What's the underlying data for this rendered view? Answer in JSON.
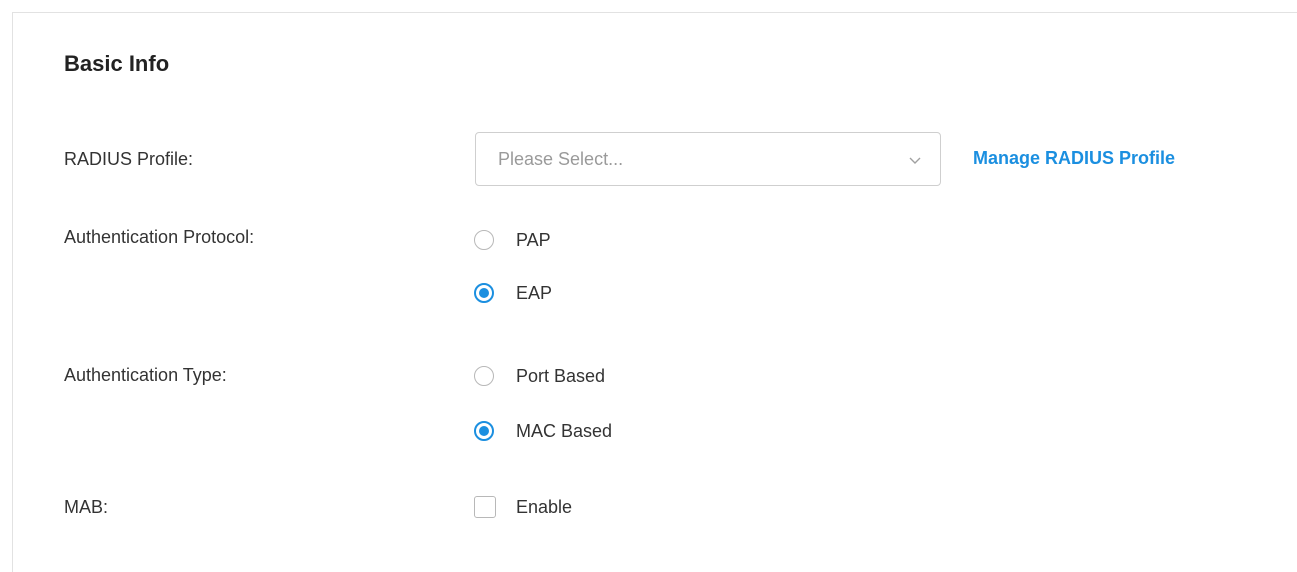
{
  "section": {
    "title": "Basic Info"
  },
  "radius_profile": {
    "label": "RADIUS Profile:",
    "placeholder": "Please Select...",
    "icon": "chevron-down-icon",
    "manage_link": "Manage RADIUS Profile"
  },
  "auth_protocol": {
    "label": "Authentication Protocol:",
    "options": [
      {
        "label": "PAP",
        "checked": false
      },
      {
        "label": "EAP",
        "checked": true
      }
    ]
  },
  "auth_type": {
    "label": "Authentication Type:",
    "options": [
      {
        "label": "Port Based",
        "checked": false
      },
      {
        "label": "MAC Based",
        "checked": true
      }
    ]
  },
  "mab": {
    "label": "MAB:",
    "checkbox_label": "Enable",
    "checked": false
  },
  "colors": {
    "accent": "#1b8fe0",
    "text": "#333333",
    "placeholder": "#9a9a9a",
    "border": "#cfcfcf"
  }
}
